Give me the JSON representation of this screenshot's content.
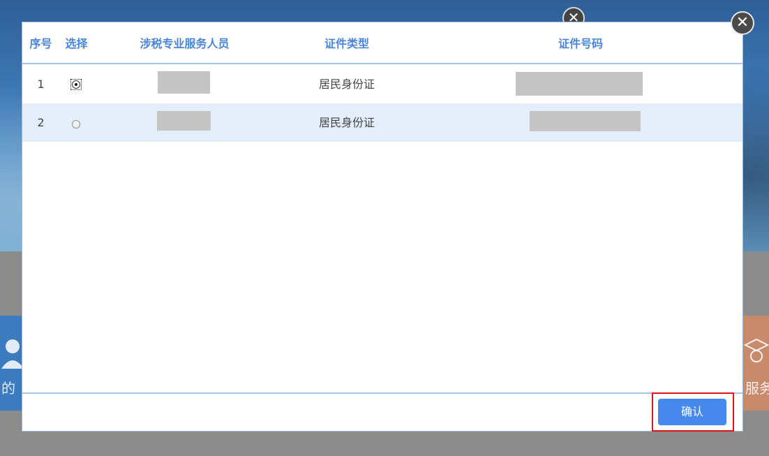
{
  "background": {
    "left_tile_text": "的",
    "right_tile_text": "服务"
  },
  "table": {
    "headers": {
      "index": "序号",
      "select": "选择",
      "person": "涉税专业服务人员",
      "id_type": "证件类型",
      "id_number": "证件号码"
    },
    "rows": [
      {
        "index": "1",
        "selected": true,
        "id_type": "居民身份证"
      },
      {
        "index": "2",
        "selected": false,
        "id_type": "居民身份证"
      }
    ]
  },
  "dialog": {
    "confirm_label": "确认"
  },
  "colors": {
    "header_text": "#4a86d8",
    "confirm_button": "#4589ee",
    "highlight_outline": "#e0141b",
    "alt_row": "#e3eefa"
  }
}
